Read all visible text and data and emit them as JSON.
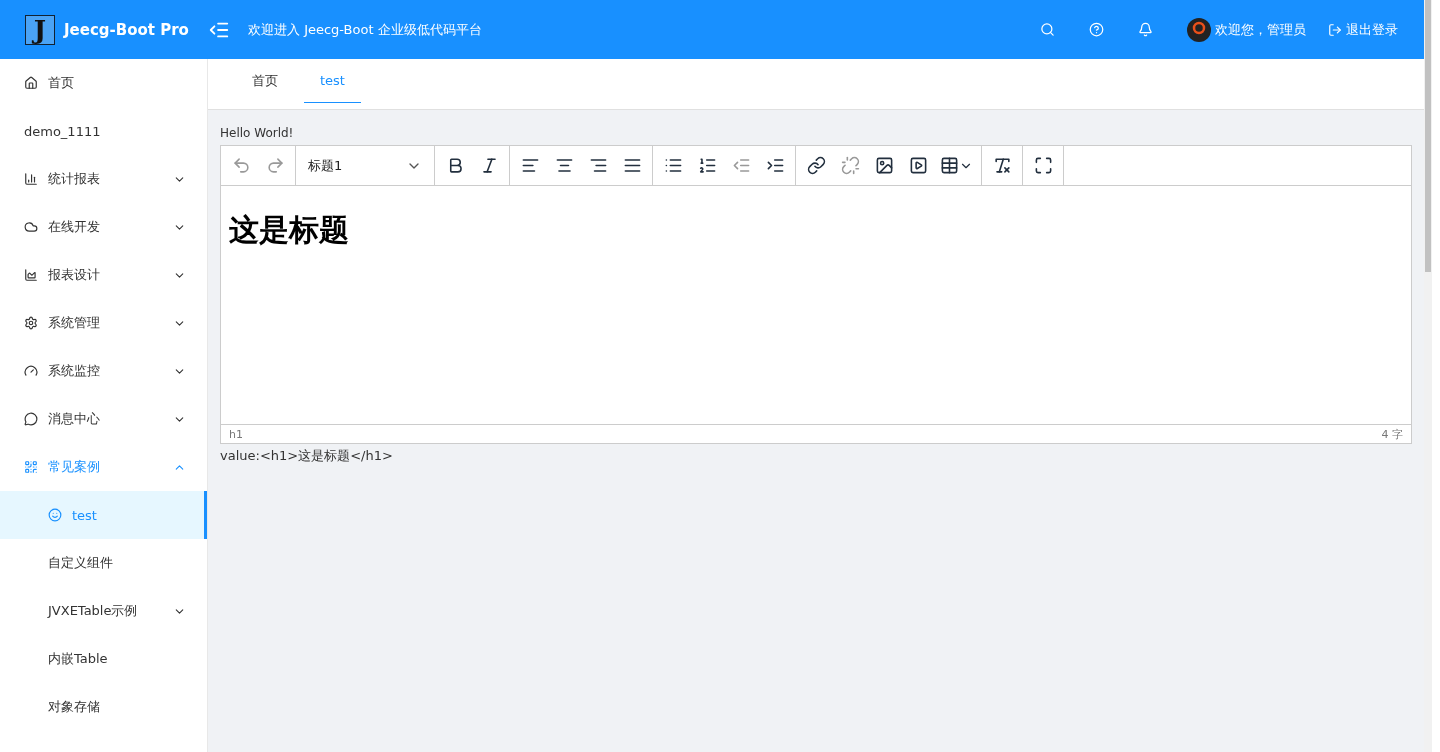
{
  "header": {
    "logo_letter": "J",
    "title": "Jeecg-Boot Pro",
    "welcome": "欢迎进入 Jeecg-Boot 企业级低代码平台",
    "user": "欢迎您，管理员",
    "logout": "退出登录"
  },
  "sidebar": {
    "items": [
      {
        "label": "首页",
        "kind": "home",
        "selected": false
      },
      {
        "label": "demo_1111",
        "selected": false
      },
      {
        "label": "统计报表",
        "kind": "bar",
        "selected": false,
        "expanded": false
      },
      {
        "label": "在线开发",
        "kind": "cloud",
        "selected": false,
        "expanded": false
      },
      {
        "label": "报表设计",
        "kind": "area",
        "selected": false,
        "expanded": false
      },
      {
        "label": "系统管理",
        "kind": "gear",
        "selected": false,
        "expanded": false
      },
      {
        "label": "系统监控",
        "kind": "gauge",
        "selected": false,
        "expanded": false
      },
      {
        "label": "消息中心",
        "kind": "message",
        "selected": false,
        "expanded": false
      },
      {
        "label": "常见案例",
        "kind": "grid",
        "selected": true,
        "expanded": true,
        "children": [
          {
            "label": "test",
            "kind": "smile",
            "selected": true
          },
          {
            "label": "自定义组件",
            "selected": false
          },
          {
            "label": "JVXETable示例",
            "selected": false,
            "expanded": false
          },
          {
            "label": "内嵌Table",
            "selected": false
          },
          {
            "label": "对象存储",
            "selected": false
          }
        ]
      }
    ]
  },
  "tabs": [
    {
      "label": "首页",
      "selected": false
    },
    {
      "label": "test",
      "selected": true
    }
  ],
  "form_label": "Hello World!",
  "editor": {
    "toolbar": [
      [
        {
          "kind": "undo",
          "disabled": true
        },
        {
          "kind": "redo",
          "disabled": true
        }
      ],
      [
        {
          "kind": "select",
          "value": "标题1"
        }
      ],
      [
        {
          "kind": "bold",
          "disabled": false
        },
        {
          "kind": "italic",
          "disabled": false
        }
      ],
      [
        {
          "kind": "align-left",
          "disabled": false
        },
        {
          "kind": "align-center",
          "disabled": false
        },
        {
          "kind": "align-right",
          "disabled": false
        },
        {
          "kind": "align-justify",
          "disabled": false
        }
      ],
      [
        {
          "kind": "bullet-list",
          "disabled": false
        },
        {
          "kind": "numbered-list",
          "disabled": false
        },
        {
          "kind": "outdent",
          "disabled": true
        },
        {
          "kind": "indent",
          "disabled": false
        }
      ],
      [
        {
          "kind": "link",
          "disabled": false
        },
        {
          "kind": "unlink",
          "disabled": true
        },
        {
          "kind": "image",
          "disabled": false
        },
        {
          "kind": "media",
          "disabled": false
        },
        {
          "kind": "table",
          "disabled": false
        }
      ],
      [
        {
          "kind": "clear-format",
          "disabled": false
        }
      ],
      [
        {
          "kind": "fullscreen",
          "disabled": false
        }
      ]
    ],
    "heading": "这是标题",
    "path": "h1",
    "word_count": "4 字"
  },
  "value_text": "value:<h1>这是标题</h1>"
}
